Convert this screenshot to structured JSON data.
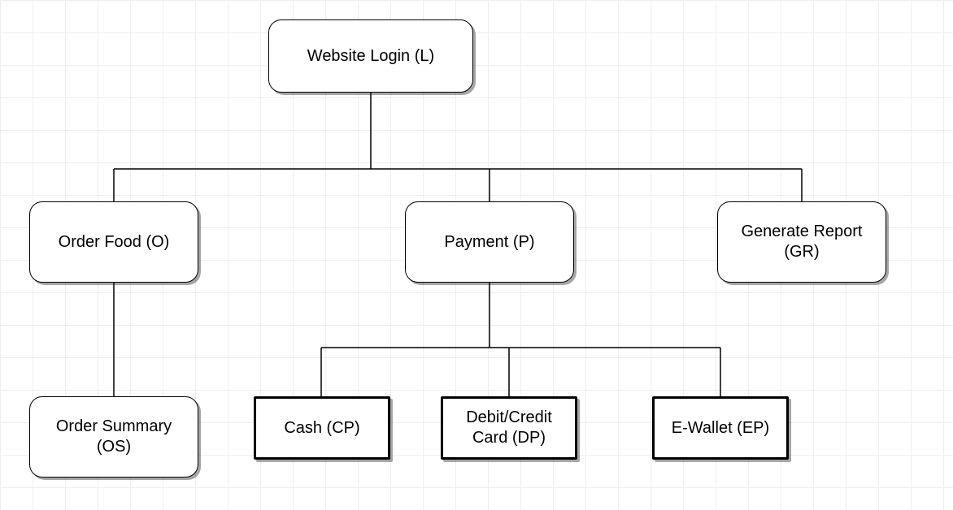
{
  "nodes": {
    "root": "Website Login (L)",
    "orderFood": "Order Food (O)",
    "payment": "Payment (P)",
    "generateReport": "Generate Report (GR)",
    "orderSummary": "Order Summary (OS)",
    "cash": "Cash (CP)",
    "card": "Debit/Credit Card (DP)",
    "ewallet": "E-Wallet (EP)"
  }
}
